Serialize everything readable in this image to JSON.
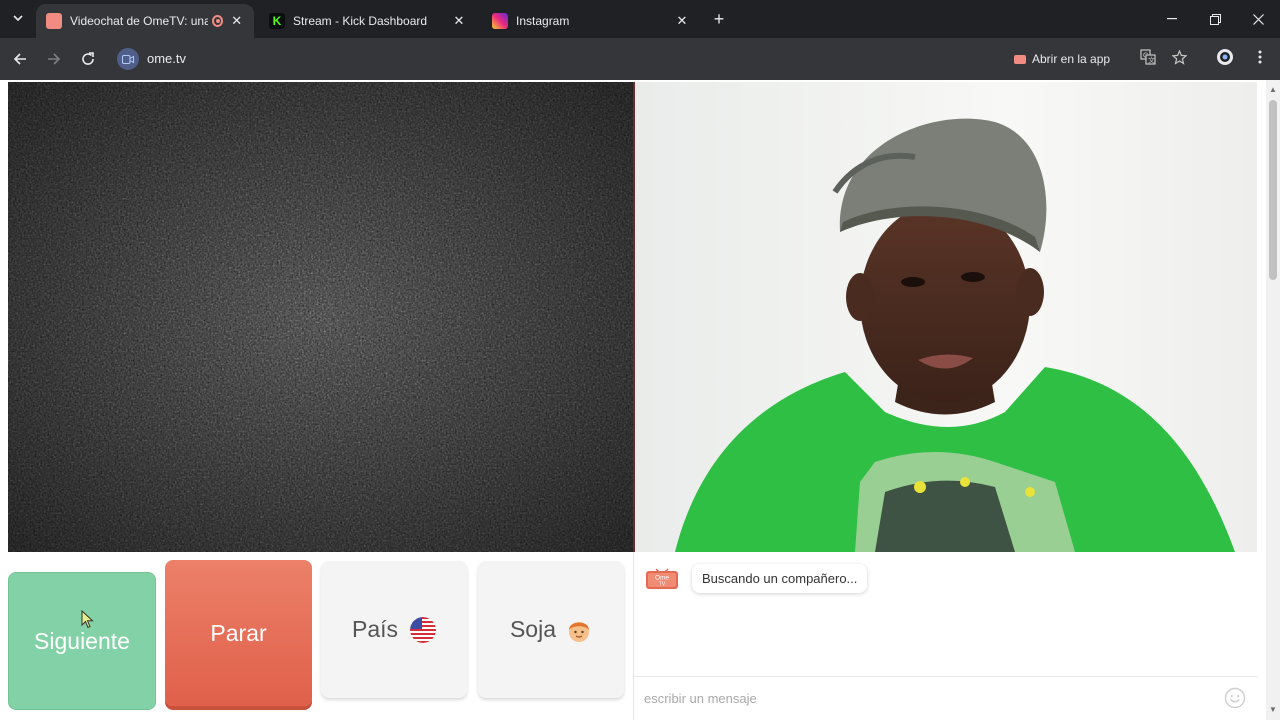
{
  "tabs": [
    {
      "title": "Videochat de OmeTV: una a",
      "favicon_color": "#f28b82",
      "active": true,
      "recording": true
    },
    {
      "title": "Stream - Kick Dashboard",
      "favicon_color": "#53fc18",
      "active": false
    },
    {
      "title": "Instagram",
      "favicon_color": "#e1306c",
      "active": false
    }
  ],
  "toolbar": {
    "url": "ome.tv",
    "open_in_app": "Abrir en la app"
  },
  "controls": {
    "next_label": "Siguiente",
    "stop_label": "Parar",
    "country_label": "País",
    "gender_label": "Soja"
  },
  "chat": {
    "logo_text": "Ome",
    "logo_subtext": "TV",
    "status_message": "Buscando un compañero...",
    "input_placeholder": "escribir un mensaje"
  },
  "colors": {
    "next": "#83d1a6",
    "stop": "#e46a54",
    "static": "#2b2b2b",
    "shirt": "#2fbf45"
  }
}
